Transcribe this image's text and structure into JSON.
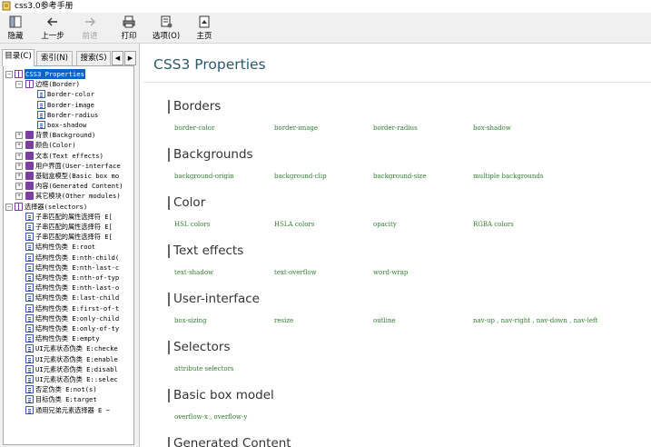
{
  "window": {
    "title": "css3.0参考手册"
  },
  "toolbar": {
    "buttons": [
      {
        "label": "隐藏",
        "icon": "hide-pane-icon"
      },
      {
        "label": "上一步",
        "icon": "back-arrow-icon"
      },
      {
        "label": "前进",
        "icon": "forward-arrow-icon"
      },
      {
        "label": "打印",
        "icon": "printer-icon"
      },
      {
        "label": "选项(O)",
        "icon": "options-icon"
      },
      {
        "label": "主页",
        "icon": "home-icon"
      }
    ]
  },
  "nav_tabs": {
    "contents": "目录(C)",
    "index": "索引(N)",
    "search": "搜索(S)"
  },
  "tree": [
    "CSS3 Properties",
    "边框(Border)",
    "Border-color",
    "Border-image",
    "Border-radius",
    "box-shadow",
    "背景(Background)",
    "颜色(Color)",
    "文本(Text effects)",
    "用户界面(User-interface",
    "基础盒模型(Basic box mo",
    "内容(Generated Content)",
    "其它模块(Other modules)",
    "选择器(selectors)",
    "子串匹配的属性选择符 E[",
    "子串匹配的属性选择符 E[",
    "子串匹配的属性选择符 E[",
    "结构性伪类 E:root",
    "结构性伪类 E:nth-child(",
    "结构性伪类 E:nth-last-c",
    "结构性伪类 E:nth-of-typ",
    "结构性伪类 E:nth-last-o",
    "结构性伪类 E:last-child",
    "结构性伪类 E:first-of-t",
    "结构性伪类 E:only-child",
    "结构性伪类 E:only-of-ty",
    "结构性伪类 E:empty",
    "UI元素状态伪类 E:checke",
    "UI元素状态伪类 E:enable",
    "UI元素状态伪类 E:disabl",
    "UI元素状态伪类 E::selec",
    "否定伪类 E:not(s)",
    "目标伪类 E:target",
    "通用兄弟元素选择器 E ~"
  ],
  "page": {
    "title": "CSS3 Properties",
    "sections": [
      {
        "heading": "Borders",
        "links": [
          "border-color",
          "border-image",
          "border-radius",
          "box-shadow"
        ]
      },
      {
        "heading": "Backgrounds",
        "links": [
          "background-origin",
          "background-clip",
          "background-size",
          "multiple backgrounds"
        ]
      },
      {
        "heading": "Color",
        "links": [
          "HSL colors",
          "HSLA colors",
          "opacity",
          "RGBA colors"
        ]
      },
      {
        "heading": "Text effects",
        "links": [
          "text-shadow",
          "text-overflow",
          "word-wrap"
        ]
      },
      {
        "heading": "User-interface",
        "links": [
          "box-sizing",
          "resize",
          "outline",
          "nav-up , nav-right , nav-down , nav-left"
        ]
      },
      {
        "heading": "Selectors",
        "links": [
          "attribute selectors"
        ]
      },
      {
        "heading": "Basic box model",
        "links": [
          "overflow-x , overflow-y"
        ]
      },
      {
        "heading": "Generated Content",
        "links": []
      }
    ]
  }
}
